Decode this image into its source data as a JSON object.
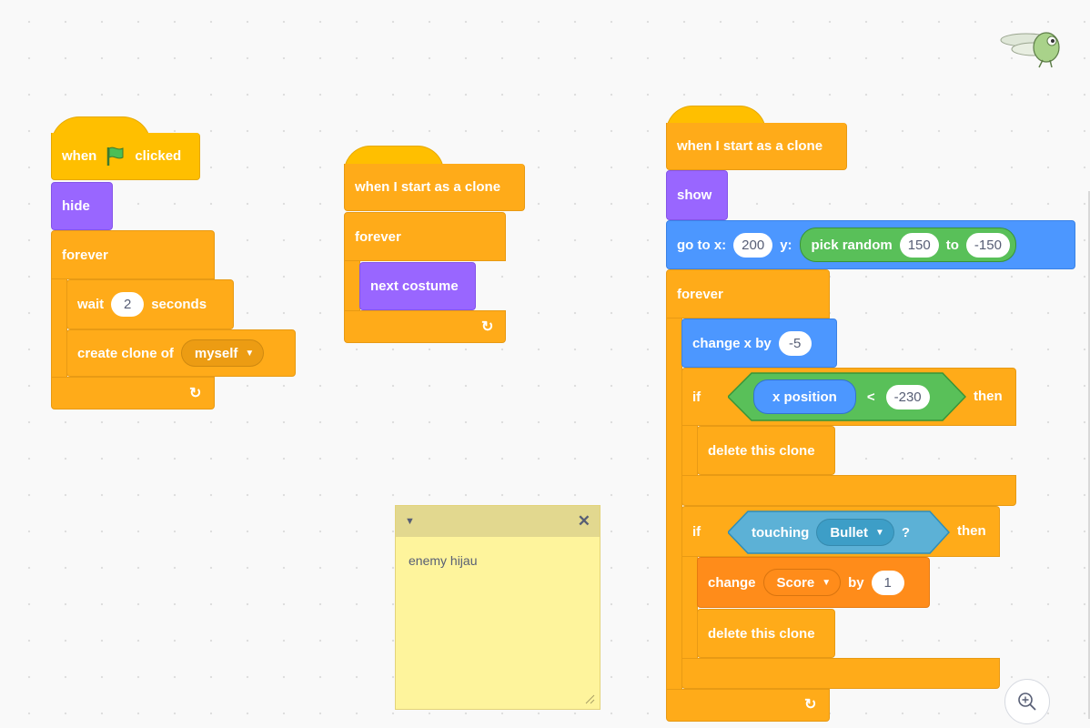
{
  "script1": {
    "when_label": "when",
    "clicked_label": "clicked",
    "hide_label": "hide",
    "forever_label": "forever",
    "wait_label": "wait",
    "wait_value": "2",
    "seconds_label": "seconds",
    "create_clone_label": "create clone of",
    "clone_target": "myself"
  },
  "script2": {
    "hat_label": "when I start as a clone",
    "forever_label": "forever",
    "next_costume_label": "next costume"
  },
  "script3": {
    "hat_label": "when I start as a clone",
    "show_label": "show",
    "goto_x_label": "go to x:",
    "x_value": "200",
    "y_label": "y:",
    "pick_random_label": "pick random",
    "random_from": "150",
    "to_label": "to",
    "random_to": "-150",
    "forever_label": "forever",
    "change_x_label": "change x by",
    "change_x_value": "-5",
    "if_label": "if",
    "x_position_label": "x position",
    "lt_symbol": "<",
    "lt_value": "-230",
    "then_label": "then",
    "delete_clone_label": "delete this clone",
    "if2_label": "if",
    "touching_label": "touching",
    "touching_target": "Bullet",
    "question_mark": "?",
    "then2_label": "then",
    "change_label": "change",
    "variable_name": "Score",
    "by_label": "by",
    "change_value": "1",
    "delete_clone2_label": "delete this clone"
  },
  "comment": {
    "text": "enemy hijau"
  },
  "colors": {
    "events": "#ffbf00",
    "control": "#ffab19",
    "looks": "#9966ff",
    "motion": "#4c97ff",
    "operators": "#59c059",
    "sensing": "#5cb1d6",
    "variables": "#ff8c1a"
  }
}
